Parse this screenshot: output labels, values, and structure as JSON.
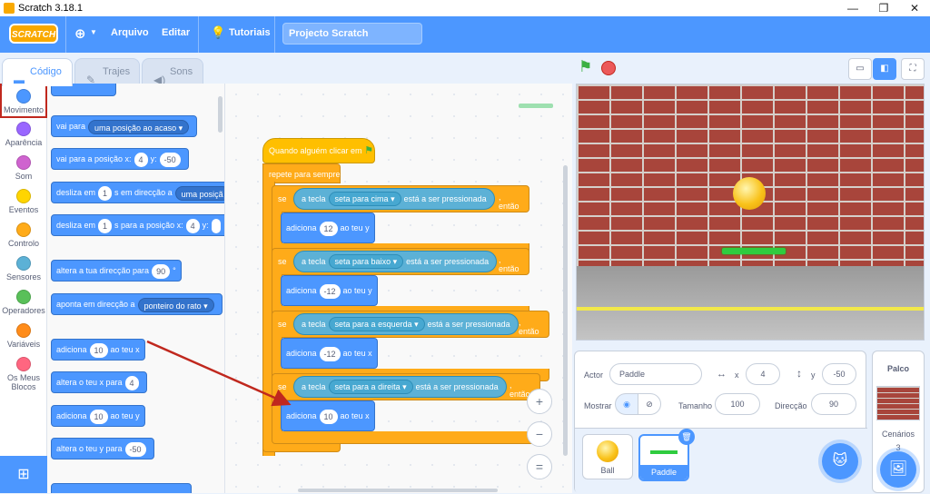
{
  "window": {
    "title": "Scratch 3.18.1",
    "minimize": "—",
    "maximize": "❐",
    "close": "✕"
  },
  "menubar": {
    "logo": "SCRATCH",
    "language_icon": "globe-icon",
    "file": "Arquivo",
    "edit": "Editar",
    "tutorials": "Tutoriais",
    "project_title": "Projecto Scratch"
  },
  "tabs": {
    "code": "Código",
    "costumes": "Trajes",
    "sounds": "Sons"
  },
  "categories": [
    {
      "label": "Movimento",
      "color": "#4c97ff"
    },
    {
      "label": "Aparência",
      "color": "#9966ff"
    },
    {
      "label": "Som",
      "color": "#cf63cf"
    },
    {
      "label": "Eventos",
      "color": "#ffd500"
    },
    {
      "label": "Controlo",
      "color": "#ffab19"
    },
    {
      "label": "Sensores",
      "color": "#5cb1d6"
    },
    {
      "label": "Operadores",
      "color": "#59c059"
    },
    {
      "label": "Variáveis",
      "color": "#ff8c1a"
    },
    {
      "label": "Os Meus Blocos",
      "color": "#ff6680"
    }
  ],
  "palette": {
    "goto": {
      "text": "vai para",
      "drop": "uma posição ao acaso"
    },
    "gotoxy": {
      "text": "vai para a posição x:",
      "x": "4",
      "ylabel": "y:",
      "y": "-50"
    },
    "glide": {
      "text": "desliza em",
      "n": "1",
      "mid": "s em direcção a",
      "drop": "uma posiçã"
    },
    "glidexy": {
      "text": "desliza em",
      "n": "1",
      "mid": "s para a posição x:",
      "x": "4",
      "ylabel": "y:"
    },
    "pointdir": {
      "text": "altera a tua direcção para",
      "v": "90",
      "unit": "°"
    },
    "pointto": {
      "text": "aponta em direcção a",
      "drop": "ponteiro do rato"
    },
    "changex": {
      "text": "adiciona",
      "v": "10",
      "suffix": "ao teu x"
    },
    "setx": {
      "text": "altera o teu x para",
      "v": "4"
    },
    "changey": {
      "text": "adiciona",
      "v": "10",
      "suffix": "ao teu y"
    },
    "sety": {
      "text": "altera o teu y para",
      "v": "-50"
    }
  },
  "script": {
    "hat": "Quando alguém clicar em",
    "forever": "repete para sempre",
    "if_label": "se",
    "then_label": ", então",
    "sensing_a": "a tecla",
    "sensing_b": "está a ser pressionada",
    "change_prefix": "adiciona",
    "ifs": [
      {
        "key": "seta para cima",
        "value": "12",
        "suffix": "ao teu y"
      },
      {
        "key": "seta para baixo",
        "value": "-12",
        "suffix": "ao teu y"
      },
      {
        "key": "seta para a esquerda",
        "value": "-12",
        "suffix": "ao teu x"
      },
      {
        "key": "seta para a direita",
        "value": "10",
        "suffix": "ao teu x"
      }
    ],
    "loop_arrow": "↻"
  },
  "zoom": {
    "in": "+",
    "out": "−",
    "reset": "="
  },
  "sprite_info": {
    "actor_label": "Actor",
    "actor": "Paddle",
    "x_label": "x",
    "x": "4",
    "y_label": "y",
    "y": "-50",
    "show_label": "Mostrar",
    "size_label": "Tamanho",
    "size": "100",
    "direction_label": "Direcção",
    "direction": "90"
  },
  "sprites": [
    {
      "name": "Ball"
    },
    {
      "name": "Paddle"
    }
  ],
  "stage_panel": {
    "title": "Palco",
    "backdrops_label": "Cenários",
    "backdrops_count": "3"
  },
  "colors": {
    "accent": "#4c97ff",
    "motion": "#4c97ff",
    "control": "#ffab19",
    "sensing": "#5cb1d6",
    "highlight": "#c0281e"
  }
}
